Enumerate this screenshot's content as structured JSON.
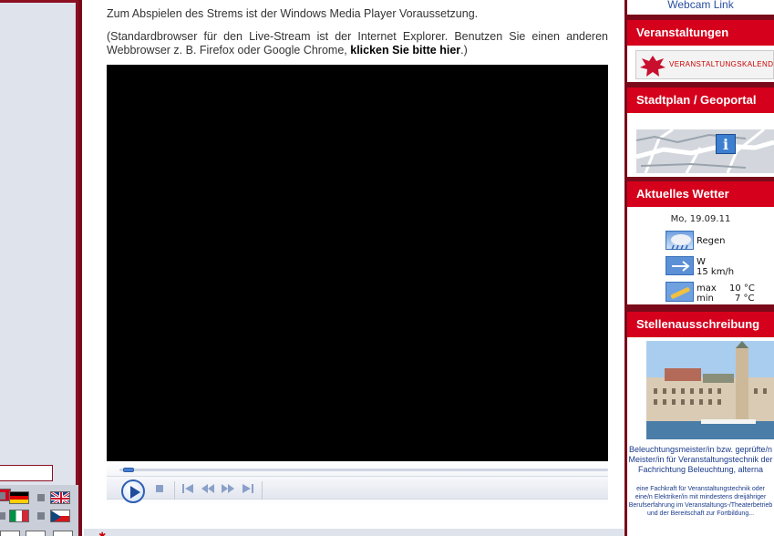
{
  "intro": {
    "line1": "Zum Abspielen des Strems ist der Windows Media Player Voraussetzung.",
    "line2": "(Standardbrowser für den Live-Stream ist der Internet Explorer. Benutzen Sie einen anderen Webbrowser z. B. Firefox oder Google Chrome, ",
    "link": "klicken Sie bitte hier",
    "line2_end": ".)"
  },
  "player": {
    "icons": [
      "play-icon",
      "stop-icon",
      "previous-icon",
      "rewind-icon",
      "fast-forward-icon",
      "next-icon"
    ]
  },
  "sidebar_right": {
    "webcam_link": "Webcam Link",
    "veranstaltungen": {
      "title": "Veranstaltungen",
      "banner_text": "VERANSTALTUNGSKALENDER PASS"
    },
    "stadtplan": {
      "title": "Stadtplan / Geoportal",
      "info_glyph": "i"
    },
    "wetter": {
      "title": "Aktuelles Wetter",
      "date": "Mo, 19.09.11",
      "condition": "Regen",
      "wind_dir": "W",
      "wind_speed": "15 km/h",
      "max_label": "max",
      "max_value": "10 °C",
      "min_label": "min",
      "min_value": "7 °C"
    },
    "stellen": {
      "title": "Stellenausschreibung",
      "heading": "Beleuchtungsmeister/in bzw. geprüfte/n Meister/in für Veranstaltungstechnik der Fachrichtung Beleuchtung, alterna",
      "body": "eine Fachkraft für Veranstaltungstechnik oder eine/n Elektriker/in mit mindestens dreijähriger Berufserfahrung im Veranstaltungs-/Theaterbetrieb und der Bereitschaft zur Fortbildung..."
    }
  },
  "colors": {
    "brand_red": "#d5001c",
    "frame_dark": "#7a0a1a",
    "link_blue": "#2a4f9e"
  }
}
